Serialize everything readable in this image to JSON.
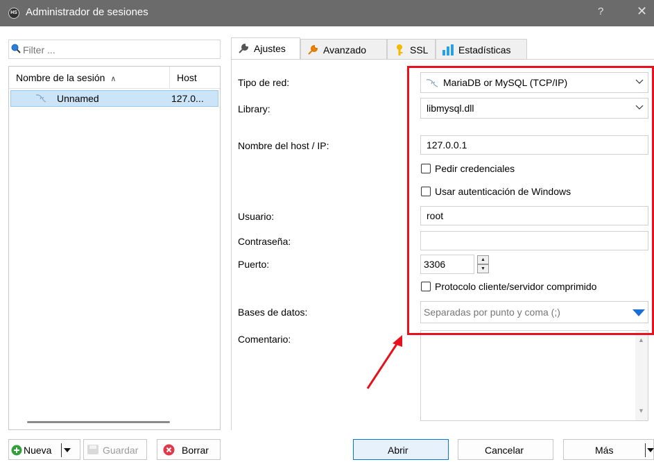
{
  "window": {
    "title": "Administrador de sesiones",
    "app_icon_text": "HS",
    "help_label": "?",
    "close_label": "✕"
  },
  "left": {
    "filter_placeholder": "Filter ...",
    "columns": {
      "name": "Nombre de la sesión",
      "host": "Host"
    },
    "sessions": [
      {
        "name": "Unnamed",
        "host": "127.0..."
      }
    ]
  },
  "tabs": [
    {
      "label": "Ajustes",
      "icon": "wrench-icon",
      "active": true
    },
    {
      "label": "Avanzado",
      "icon": "wrench-orange-icon",
      "active": false
    },
    {
      "label": "SSL",
      "icon": "key-icon",
      "active": false
    },
    {
      "label": "Estadísticas",
      "icon": "bar-chart-icon",
      "active": false
    }
  ],
  "form": {
    "labels": {
      "network_type": "Tipo de red:",
      "library": "Library:",
      "host": "Nombre del host / IP:",
      "user": "Usuario:",
      "password": "Contraseña:",
      "port": "Puerto:",
      "databases": "Bases de datos:",
      "comment": "Comentario:"
    },
    "network_type": "MariaDB or MySQL (TCP/IP)",
    "library": "libmysql.dll",
    "host": "127.0.0.1",
    "ask_credentials": {
      "label": "Pedir credenciales",
      "checked": false
    },
    "windows_auth": {
      "label": "Usar autenticación de Windows",
      "checked": false
    },
    "user": "root",
    "password": "",
    "port": "3306",
    "compressed": {
      "label": "Protocolo cliente/servidor comprimido",
      "checked": false
    },
    "databases_placeholder": "Separadas por punto y coma (;)",
    "comment": ""
  },
  "buttons": {
    "new": "Nueva",
    "save": "Guardar",
    "delete": "Borrar",
    "open": "Abrir",
    "cancel": "Cancelar",
    "more": "Más"
  },
  "colors": {
    "annotation": "#e8101a",
    "selection": "#cce4f7",
    "accent": "#0078d4"
  }
}
